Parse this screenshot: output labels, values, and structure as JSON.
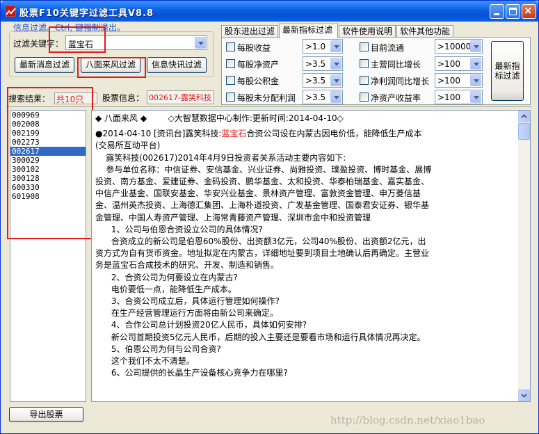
{
  "window": {
    "title": "股票F10关键字过滤工具V8.8"
  },
  "info_text": "信息过滤。Ctrl, 键强制退出。",
  "filter": {
    "keyword_label": "过滤关键字：",
    "keyword_value": "蓝宝石",
    "buttons": {
      "latest": "最新消息过滤",
      "bamian": "八面来风过滤",
      "quick": "信息快讯过滤"
    }
  },
  "search": {
    "result_label": "搜索结果：",
    "result_value": "共10只",
    "stock_label": "股票信息：",
    "stock_value": "002617-露笑科技"
  },
  "tabs": [
    {
      "label": "股东进出过滤"
    },
    {
      "label": "最新指标过滤",
      "active": true
    },
    {
      "label": "软件使用说明"
    },
    {
      "label": "软件其他功能"
    }
  ],
  "indicators": [
    {
      "label": "每股收益",
      "value": ">1.0"
    },
    {
      "label": "每股净资产",
      "value": ">3.5"
    },
    {
      "label": "每股公积金",
      "value": ">3.5"
    },
    {
      "label": "每股未分配利润",
      "value": ">3.5"
    },
    {
      "label": "目前流通",
      "value": ">10000"
    },
    {
      "label": "主营同比增长",
      "value": ">100"
    },
    {
      "label": "净利润同比增长",
      "value": ">100"
    },
    {
      "label": "净资产收益率",
      "value": ">100"
    }
  ],
  "indicator_filter_button": "最新指标过滤",
  "stock_list": [
    "000969",
    "002008",
    "002199",
    "002273",
    "002617",
    "300029",
    "300102",
    "300128",
    "600330",
    "601908"
  ],
  "selected_stock": "002617",
  "article": {
    "header_left": "◆ 八面来风 ◆",
    "header_right": "◇大智慧数据中心制作:更新时间:2014-04-10◇",
    "headline_pre": "●2014-04-10 [资讯台]露笑科技:",
    "headline_keyword": "蓝宝石",
    "headline_post": "合资公司设在内蒙古因电价低，能降低生产成本(交易所互动平台)",
    "paragraphs": [
      "    露笑科技(002617)2014年4月9日投资者关系活动主要内容如下:",
      "    参与单位名称：中信证券、安信基金、兴业证券、尚雅投资、璞盈投资、博时基金、展博投资、南方基金、爱建证券、金码投资、鹏华基金、太和投资、华泰柏瑞基金、嘉实基金、中信产业基金、国联安基金、华安兴业基金、景林资产管理、富敦资金管理、申万菱信基金、温州英杰投资、上海德汇集团、上海朴道投资、广发基金管理、国泰君安证券、银华基金管理、中国人寿资产管理、上海常青藤资产管理、深圳市金中和投资管理",
      "      1、公司与伯恩合资设立公司的具体情况?",
      "      合资成立的新公司是伯恩60%股份、出资额3亿元，公司40%股份、出资额2亿元，出资方式为自有货币资金。地址拟定在内蒙古，详细地址要到项目土地确认后再确定。主营业务是蓝宝石合成技术的研究、开发、制造和销售。",
      "      2、合资公司为何要设立在内蒙古?",
      "      电价要低一点，能降低生产成本。",
      "      3、合资公司成立后，具体运行管理如何操作?",
      "      在生产经营管理运行方面将由新公司来确定。",
      "      4、合作公司总计划投资20亿人民币，具体如何安排?",
      "      新公司首期投资5亿元人民币，后期的投入主要还是要看市场和运行具体情况再决定。",
      "      5、伯恩公司为何与公司合资?",
      "      这个我们不太不清楚。",
      "      6、公司提供的长晶生产设备核心竞争力在哪里?"
    ]
  },
  "export_button": "导出股票",
  "watermark": "http://blog.csdn.net/xiao1bao",
  "colors": {
    "highlight_red": "#e21a1a",
    "selection_blue": "#316ac5",
    "info_blue": "#1a4ed6"
  }
}
